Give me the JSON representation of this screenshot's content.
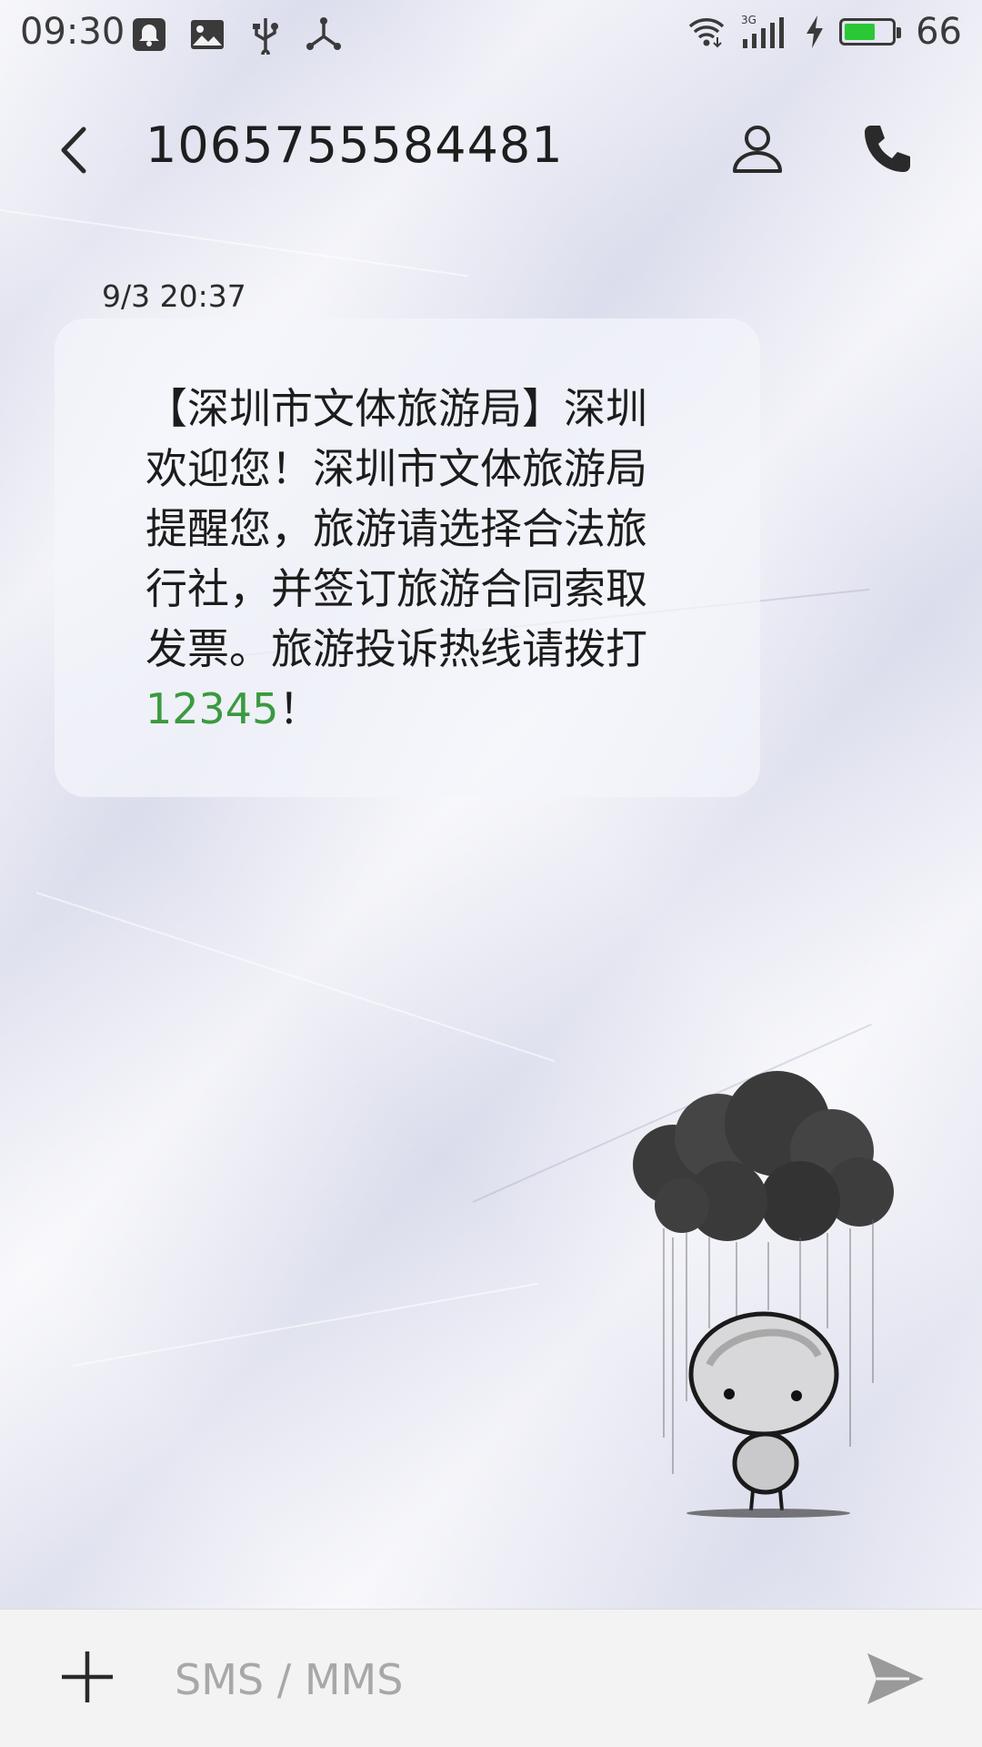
{
  "status_bar": {
    "time": "09:30",
    "network": "3G",
    "battery_level": "66",
    "battery_fill_fraction": 0.66,
    "icons_left": [
      "notification-icon",
      "image-icon",
      "usb-icon",
      "share-icon"
    ],
    "icons_right": [
      "wifi-icon",
      "signal-icon",
      "charging-icon",
      "battery-icon"
    ],
    "battery_color": "#2ac837"
  },
  "header": {
    "title": "1065755584481",
    "icons": [
      "back-icon",
      "contact-icon",
      "phone-icon"
    ]
  },
  "messages": [
    {
      "timestamp": "9/3 20:37",
      "text_lines": [
        "【深圳市文体旅游局】深圳",
        "欢迎您！深圳市文体旅游局",
        "提醒您，旅游请选择合法旅",
        "行社，并签订旅游合同索取",
        "发票。旅游投诉热线请拨打"
      ],
      "phone_link": "12345",
      "suffix": "！",
      "link_color": "#3a9a3f"
    }
  ],
  "composer": {
    "placeholder": "SMS / MMS",
    "icons": [
      "add-icon",
      "send-icon"
    ]
  }
}
